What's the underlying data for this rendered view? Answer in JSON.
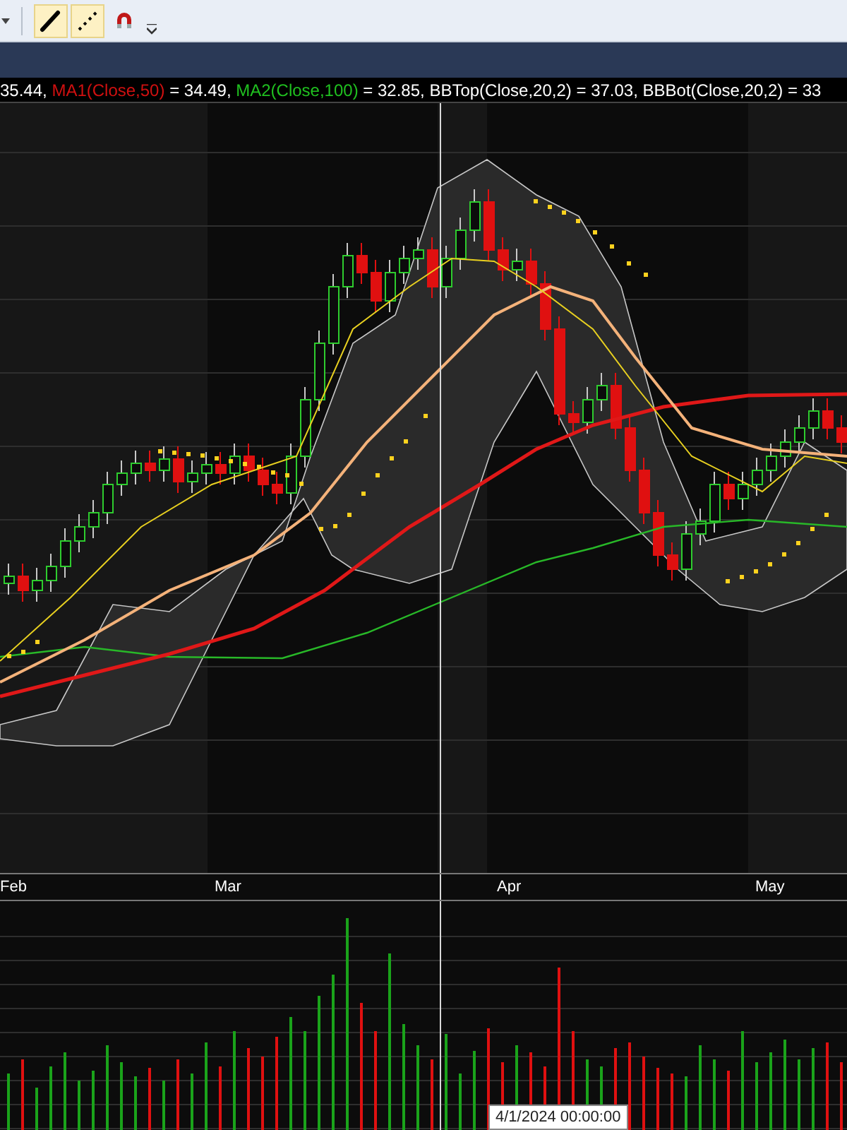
{
  "toolbar": {
    "tools": [
      {
        "kind": "pen",
        "selected": true
      },
      {
        "kind": "dotted",
        "selected": true
      },
      {
        "kind": "magnet",
        "selected": false
      }
    ]
  },
  "legend": [
    {
      "text": "35.44, ",
      "color": "#ffffff"
    },
    {
      "text": "MA1(Close,50)",
      "color": "#d01010"
    },
    {
      "text": " = 34.49, ",
      "color": "#ffffff"
    },
    {
      "text": "MA2(Close,100)",
      "color": "#20c020"
    },
    {
      "text": " = 32.85, ",
      "color": "#ffffff"
    },
    {
      "text": "BBTop(Close,20,2) = 37.03, BBBot(Close,20,2) = 33",
      "color": "#ffffff"
    }
  ],
  "x_axis": [
    "Feb",
    "Mar",
    "Apr",
    "May"
  ],
  "crosshair_label": "4/1/2024 00:00:00"
}
